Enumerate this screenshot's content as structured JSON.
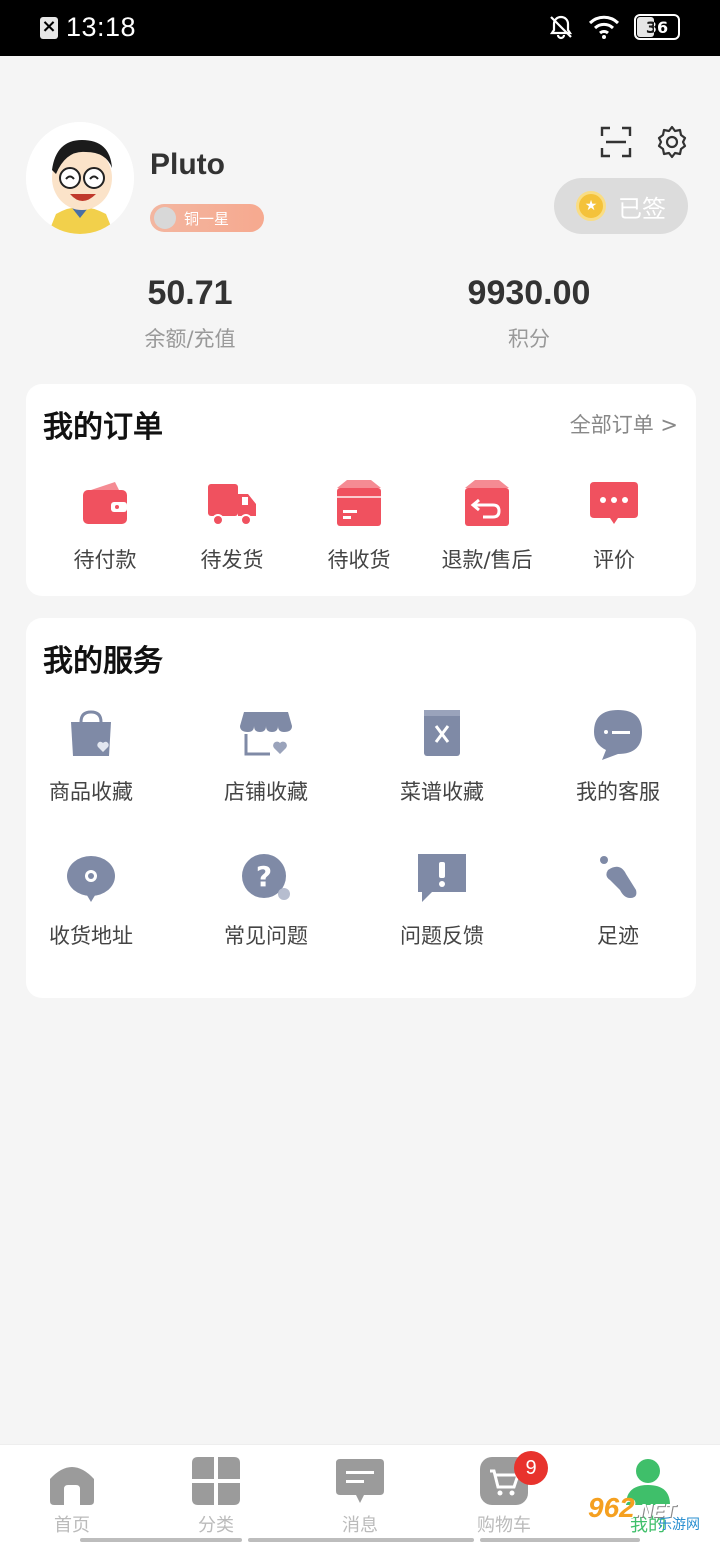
{
  "status_bar": {
    "time": "13:18",
    "battery": "36"
  },
  "profile": {
    "username": "Pluto",
    "level": "铜一星",
    "signed_label": "已签"
  },
  "stats": [
    {
      "value": "50.71",
      "label": "余额/充值"
    },
    {
      "value": "9930.00",
      "label": "积分"
    }
  ],
  "orders": {
    "title": "我的订单",
    "more": "全部订单 >",
    "items": [
      {
        "label": "待付款",
        "icon": "wallet-icon"
      },
      {
        "label": "待发货",
        "icon": "truck-icon"
      },
      {
        "label": "待收货",
        "icon": "box-icon"
      },
      {
        "label": "退款/售后",
        "icon": "return-icon"
      },
      {
        "label": "评价",
        "icon": "comment-icon"
      }
    ]
  },
  "services": {
    "title": "我的服务",
    "items": [
      {
        "label": "商品收藏",
        "icon": "bag-heart-icon"
      },
      {
        "label": "店铺收藏",
        "icon": "store-heart-icon"
      },
      {
        "label": "菜谱收藏",
        "icon": "recipe-book-icon"
      },
      {
        "label": "我的客服",
        "icon": "chat-icon"
      },
      {
        "label": "收货地址",
        "icon": "location-icon"
      },
      {
        "label": "常见问题",
        "icon": "question-icon"
      },
      {
        "label": "问题反馈",
        "icon": "feedback-icon"
      },
      {
        "label": "足迹",
        "icon": "footprint-icon"
      }
    ]
  },
  "tabbar": {
    "items": [
      {
        "label": "首页",
        "icon": "home-icon"
      },
      {
        "label": "分类",
        "icon": "category-icon"
      },
      {
        "label": "消息",
        "icon": "message-icon"
      },
      {
        "label": "购物车",
        "icon": "cart-icon",
        "badge": "9"
      },
      {
        "label": "我的",
        "icon": "profile-icon"
      }
    ]
  },
  "watermark": {
    "logo": "962",
    "net": ".NET",
    "sub": "乐游网"
  },
  "colors": {
    "accent": "#f0515f",
    "service_icon": "#7f8aa6",
    "background": "#f5f5f5"
  }
}
